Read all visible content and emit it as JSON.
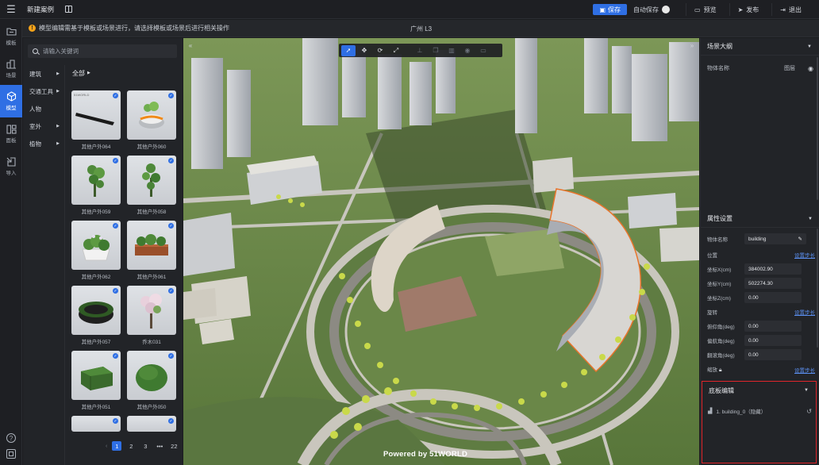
{
  "topbar": {
    "menu_icon": "menu-icon",
    "project_title": "新建案例",
    "save_label": "保存",
    "autosave_label": "自动保存",
    "preview_label": "预览",
    "publish_label": "发布",
    "exit_label": "退出"
  },
  "notice": {
    "icon": "!",
    "text": "模型编辑需基于模板或场景进行，请选择模板或场景后进行相关操作"
  },
  "scene_name": "广州 L3",
  "rail": {
    "items": [
      {
        "label": "模板",
        "icon": "folder-icon"
      },
      {
        "label": "场景",
        "icon": "city-icon"
      },
      {
        "label": "模型",
        "icon": "cube-icon"
      },
      {
        "label": "面板",
        "icon": "panel-icon"
      },
      {
        "label": "导入",
        "icon": "import-icon"
      }
    ],
    "help_icon": "?"
  },
  "model_panel": {
    "search_placeholder": "请输入关键词",
    "categories": [
      {
        "label": "建筑",
        "has_children": true
      },
      {
        "label": "交通工具",
        "has_children": true
      },
      {
        "label": "人物",
        "has_children": false
      },
      {
        "label": "室外",
        "has_children": true
      },
      {
        "label": "植物",
        "has_children": true
      }
    ],
    "grid_title": "全部",
    "items": [
      {
        "label": "其他户外064"
      },
      {
        "label": "其他户外060"
      },
      {
        "label": "其他户外059"
      },
      {
        "label": "其他户外058"
      },
      {
        "label": "其他户外062"
      },
      {
        "label": "其他户外061"
      },
      {
        "label": "其他户外057"
      },
      {
        "label": "乔木031"
      },
      {
        "label": "其他户外051"
      },
      {
        "label": "其他户外050"
      },
      {
        "label": ""
      },
      {
        "label": ""
      }
    ],
    "check_mark": "✓",
    "pagination": {
      "prev": "‹",
      "pages": [
        "1",
        "2",
        "3"
      ],
      "ellipsis": "•••",
      "last": "22",
      "next": "›",
      "current": "1"
    }
  },
  "viewport": {
    "powered_by": "Powered by 51WORLD",
    "toolbar": [
      "select-icon",
      "move-icon",
      "rotate-icon",
      "scale-icon",
      "ground-icon",
      "copy-icon",
      "delete-icon",
      "hide-icon",
      "lock-icon"
    ]
  },
  "right_panel": {
    "outline_title": "场景大纲",
    "outline_name_header": "物体名称",
    "outline_layer": "图层",
    "props_title": "属性设置",
    "object_name_label": "物体名称",
    "object_name_value": "building",
    "position_label": "位置",
    "position_link": "设置步长",
    "x_label": "坐标X(cm)",
    "x_value": "384002.90",
    "y_label": "坐标Y(cm)",
    "y_value": "502274.30",
    "z_label": "坐标Z(cm)",
    "z_value": "0.00",
    "rotation_label": "旋转",
    "rotation_link": "设置步长",
    "pitch_label": "俯仰角(deg)",
    "pitch_value": "0.00",
    "yaw_label": "偏航角(deg)",
    "yaw_value": "0.00",
    "roll_label": "翻滚角(deg)",
    "roll_value": "0.00",
    "scale_label": "缩放",
    "scale_link": "设置步长",
    "floor_title": "底板编辑",
    "floor_item": "1. building_0（隐藏）"
  },
  "colors": {
    "accent": "#2f6fe4",
    "highlight_border": "#e0262b",
    "warning": "#f4a21a"
  }
}
